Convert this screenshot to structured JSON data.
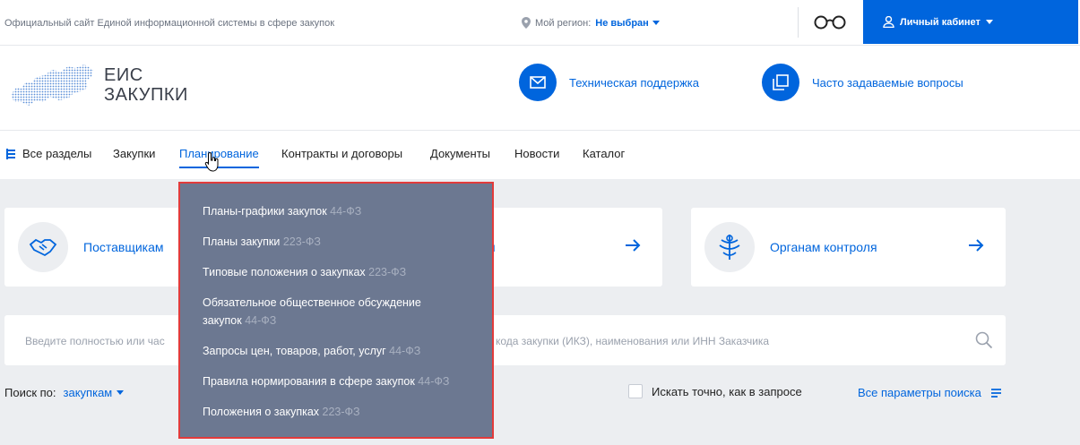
{
  "topbar": {
    "site_description": "Официальный сайт Единой информационной системы в сфере закупок",
    "region_label": "Мой регион:",
    "region_value": "Не выбран",
    "cabinet_label": "Личный кабинет"
  },
  "header": {
    "logo_line1": "ЕИС",
    "logo_line2": "ЗАКУПКИ",
    "support_label": "Техническая поддержка",
    "faq_label": "Часто задаваемые вопросы"
  },
  "nav": {
    "all_sections": "Все разделы",
    "items": [
      "Закупки",
      "Планирование",
      "Контракты и договоры",
      "Документы",
      "Новости",
      "Каталог"
    ],
    "active": "Планирование"
  },
  "cards": {
    "suppliers": "Поставщикам",
    "partial_label": "м",
    "control": "Органам контроля"
  },
  "search": {
    "placeholder_start": "Введите полностью или час",
    "placeholder_end": "кода закупки (ИКЗ), наименования или ИНН Заказчика",
    "search_by_label": "Поиск по:",
    "search_by_value": "закупкам",
    "exact_label": "Искать точно, как в запросе",
    "all_params": "Все параметры поиска"
  },
  "dropdown": {
    "items": [
      {
        "title": "Планы-графики закупок",
        "law": "44-ФЗ"
      },
      {
        "title": "Планы закупки",
        "law": "223-ФЗ"
      },
      {
        "title": "Типовые положения о закупках",
        "law": "223-ФЗ"
      },
      {
        "title": "Обязательное общественное обсуждение закупок",
        "law": "44-ФЗ"
      },
      {
        "title": "Запросы цен, товаров, работ, услуг",
        "law": "44-ФЗ"
      },
      {
        "title": "Правила нормирования в сфере закупок",
        "law": "44-ФЗ"
      },
      {
        "title": "Положения о закупках",
        "law": "223-ФЗ"
      }
    ]
  },
  "colors": {
    "accent": "#0065dd",
    "dropdown_bg": "#6c7891",
    "highlight_border": "#e23b3b",
    "content_bg": "#eceef1"
  }
}
